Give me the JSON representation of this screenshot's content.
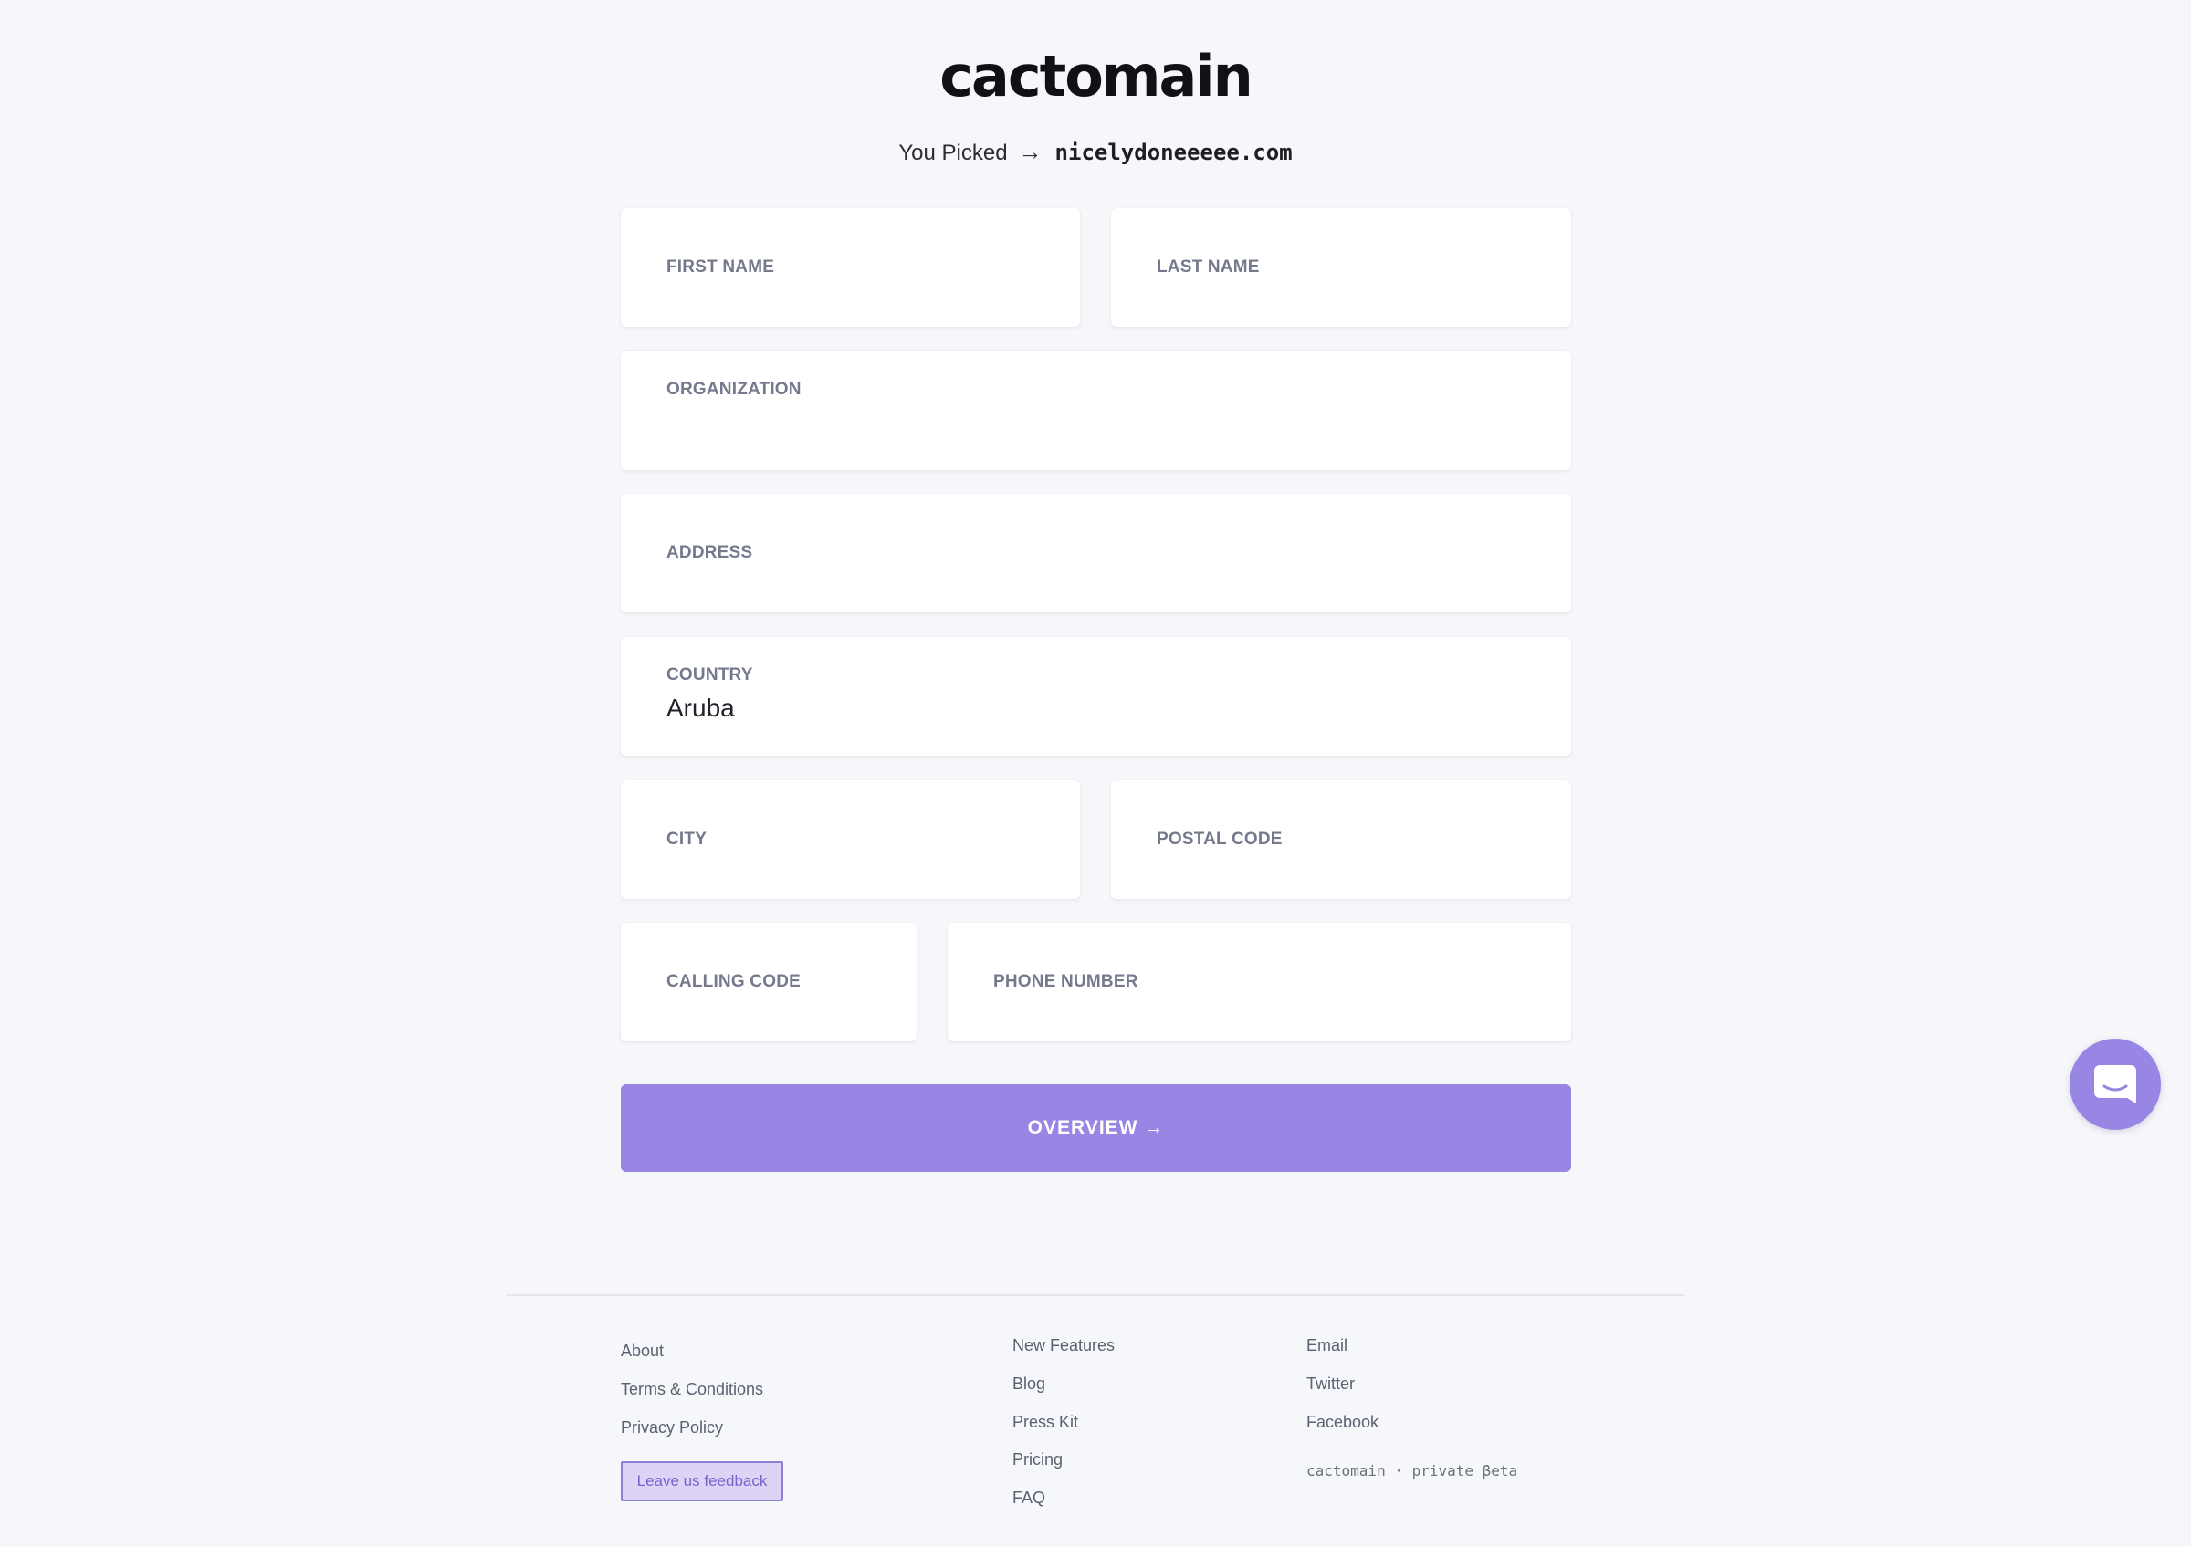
{
  "brand": {
    "logo_text": "cactomain"
  },
  "selection": {
    "prefix": "You Picked",
    "arrow": "→",
    "domain": "nicelydoneeeee.com"
  },
  "form": {
    "first_name_label": "FIRST NAME",
    "last_name_label": "LAST NAME",
    "organization_label": "ORGANIZATION",
    "address_label": "ADDRESS",
    "country_label": "COUNTRY",
    "country_value": "Aruba",
    "city_label": "CITY",
    "postal_code_label": "POSTAL CODE",
    "calling_code_label": "CALLING CODE",
    "phone_number_label": "PHONE NUMBER",
    "submit_label": "OVERVIEW →"
  },
  "footer": {
    "col1": [
      "About",
      "Terms & Conditions",
      "Privacy Policy"
    ],
    "feedback_label": "Leave us feedback",
    "col2": [
      "New Features",
      "Blog",
      "Press Kit",
      "Pricing",
      "FAQ"
    ],
    "col3": [
      "Email",
      "Twitter",
      "Facebook"
    ],
    "beta_text": "cactomain · private βeta"
  },
  "chat": {
    "icon": "chat-bubble-icon"
  },
  "colors": {
    "background": "#f6f7fa",
    "accent": "#9985e3",
    "label": "#747a8c",
    "feedback_bg": "#dcd3f7"
  }
}
